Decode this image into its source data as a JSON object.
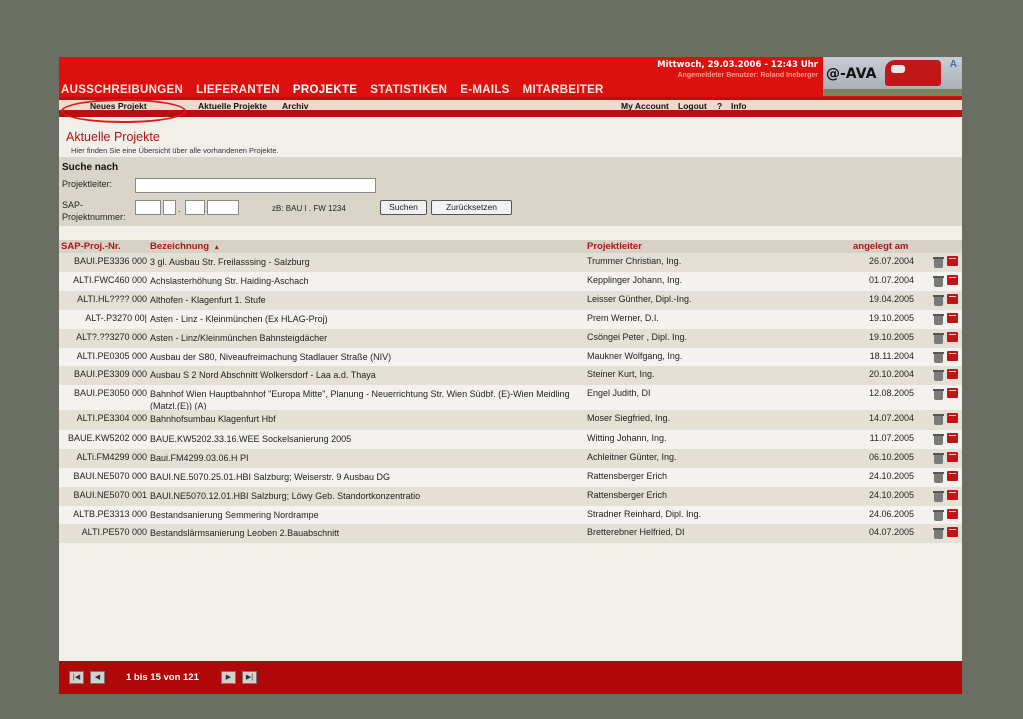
{
  "header": {
    "date": "Mittwoch, 29.03.2006 - 12:43 Uhr",
    "user": "Angemeldeter Benutzer: Roland Ineberger",
    "logo_text": "@-AVA",
    "logo_mark": "A",
    "nav": [
      "AUSSCHREIBUNGEN",
      "LIEFERANTEN",
      "PROJEKTE",
      "STATISTIKEN",
      "E-MAILS",
      "MITARBEITER"
    ],
    "active_nav": "PROJEKTE"
  },
  "subnav": {
    "neues_projekt": "Neues Projekt",
    "aktuelle": "Aktuelle Projekte",
    "archiv": "Archiv",
    "my_account": "My Account",
    "logout": "Logout",
    "help": "?",
    "info": "Info"
  },
  "page": {
    "title": "Aktuelle Projekte",
    "subtitle": "Hier finden Sie eine Übersicht über alle vorhandenen Projekte."
  },
  "search": {
    "heading": "Suche nach",
    "projektleiter_label": "Projektleiter:",
    "sap_label_1": "SAP-",
    "sap_label_2": "Projektnummer:",
    "sep1": ".",
    "sep2": ".",
    "hint": "zB: BAU I . FW 1234",
    "search_button": "Suchen",
    "reset_button": "Zurücksetzen"
  },
  "table": {
    "headers": {
      "nr": "SAP-Proj.-Nr.",
      "bezeichnung": "Bezeichnung",
      "sort_indicator": "▴",
      "projektleiter": "Projektleiter",
      "angelegt": "angelegt am"
    },
    "rows": [
      {
        "nr": "BAUI.PE3336 000",
        "bezeichnung": "3 gl. Ausbau Str. Freilasssing - Salzburg",
        "projektleiter": "Trummer Christian, Ing.",
        "angelegt": "26.07.2004"
      },
      {
        "nr": "ALTI.FWC460 000",
        "bezeichnung": "Achslasterhöhung Str. Haiding-Aschach",
        "projektleiter": "Kepplinger Johann, Ing.",
        "angelegt": "01.07.2004"
      },
      {
        "nr": "ALTI.HL???? 000",
        "bezeichnung": "Althofen - Klagenfurt 1. Stufe",
        "projektleiter": "Leisser Günther, Dipl.-Ing.",
        "angelegt": "19.04.2005"
      },
      {
        "nr": "ALT-.P3270 00|",
        "bezeichnung": "Asten - Linz - Kleinmünchen (Ex HLAG-Proj)",
        "projektleiter": "Prem Werner, D.I.",
        "angelegt": "19.10.2005"
      },
      {
        "nr": "ALT?.??3270 000",
        "bezeichnung": "Asten - Linz/Kleinmünchen Bahnsteigdächer",
        "projektleiter": "Csöngei Peter , Dipl. Ing.",
        "angelegt": "19.10.2005"
      },
      {
        "nr": "ALTI.PE0305 000",
        "bezeichnung": "Ausbau der S80, Niveaufreimachung Stadlauer Straße (NIV)",
        "projektleiter": "Maukner Wolfgang, Ing.",
        "angelegt": "18.11.2004"
      },
      {
        "nr": "BAUI.PE3309 000",
        "bezeichnung": "Ausbau S 2 Nord Abschnitt Wolkersdorf - Laa a.d. Thaya",
        "projektleiter": "Steiner Kurt, Ing.",
        "angelegt": "20.10.2004"
      },
      {
        "nr": "BAUI.PE3050 000",
        "bezeichnung": "Bahnhof Wien Hauptbahnhof \"Europa Mitte\", Planung - Neuerrichtung Str. Wien Südbf. (E)-Wien Meidling (Matzl.(E)) (A)",
        "projektleiter": "Engel Judith, DI",
        "angelegt": "12.08.2005"
      },
      {
        "nr": "ALTI.PE3304 000",
        "bezeichnung": "Bahnhofsumbau Klagenfurt Hbf",
        "projektleiter": "Moser Siegfried, Ing.",
        "angelegt": "14.07.2004"
      },
      {
        "nr": "BAUE.KW5202 000",
        "bezeichnung": "BAUE.KW5202.33.16.WEE Sockelsanierung 2005",
        "projektleiter": "Witting Johann, Ing.",
        "angelegt": "11.07.2005"
      },
      {
        "nr": "ALTi.FM4299 000",
        "bezeichnung": "Baui.FM4299.03.06.H PI",
        "projektleiter": "Achleitner Günter, Ing.",
        "angelegt": "06.10.2005"
      },
      {
        "nr": "BAUI.NE5070 000",
        "bezeichnung": "BAUI.NE.5070.25.01.HBI Salzburg; Weiserstr. 9 Ausbau DG",
        "projektleiter": "Rattensberger Erich",
        "angelegt": "24.10.2005"
      },
      {
        "nr": "BAUI.NE5070 001",
        "bezeichnung": "BAUI.NE5070.12.01.HBI Salzburg; Löwy Geb. Standortkonzentratio",
        "projektleiter": "Rattensberger Erich",
        "angelegt": "24.10.2005"
      },
      {
        "nr": "ALTB.PE3313 000",
        "bezeichnung": "Bestandsanierung Semmering Nordrampe",
        "projektleiter": "Stradner Reinhard, Dipl. Ing.",
        "angelegt": "24.06.2005"
      },
      {
        "nr": "ALTI.PE570 000",
        "bezeichnung": "Bestandslärmsanierung Leoben 2.Bauabschnitt",
        "projektleiter": "Bretterebner Helfried, DI",
        "angelegt": "04.07.2005"
      }
    ],
    "row_icons": [
      "trash-icon",
      "book-icon"
    ]
  },
  "pagination": {
    "info": "1 bis 15 von 121",
    "icons": [
      "first-page-icon",
      "prev-page-icon",
      "next-page-icon",
      "last-page-icon"
    ]
  },
  "colors": {
    "brand_red": "#dd1010",
    "dark_red": "#b00808",
    "header_text_red": "#b01414",
    "background": "#f1efe9"
  }
}
